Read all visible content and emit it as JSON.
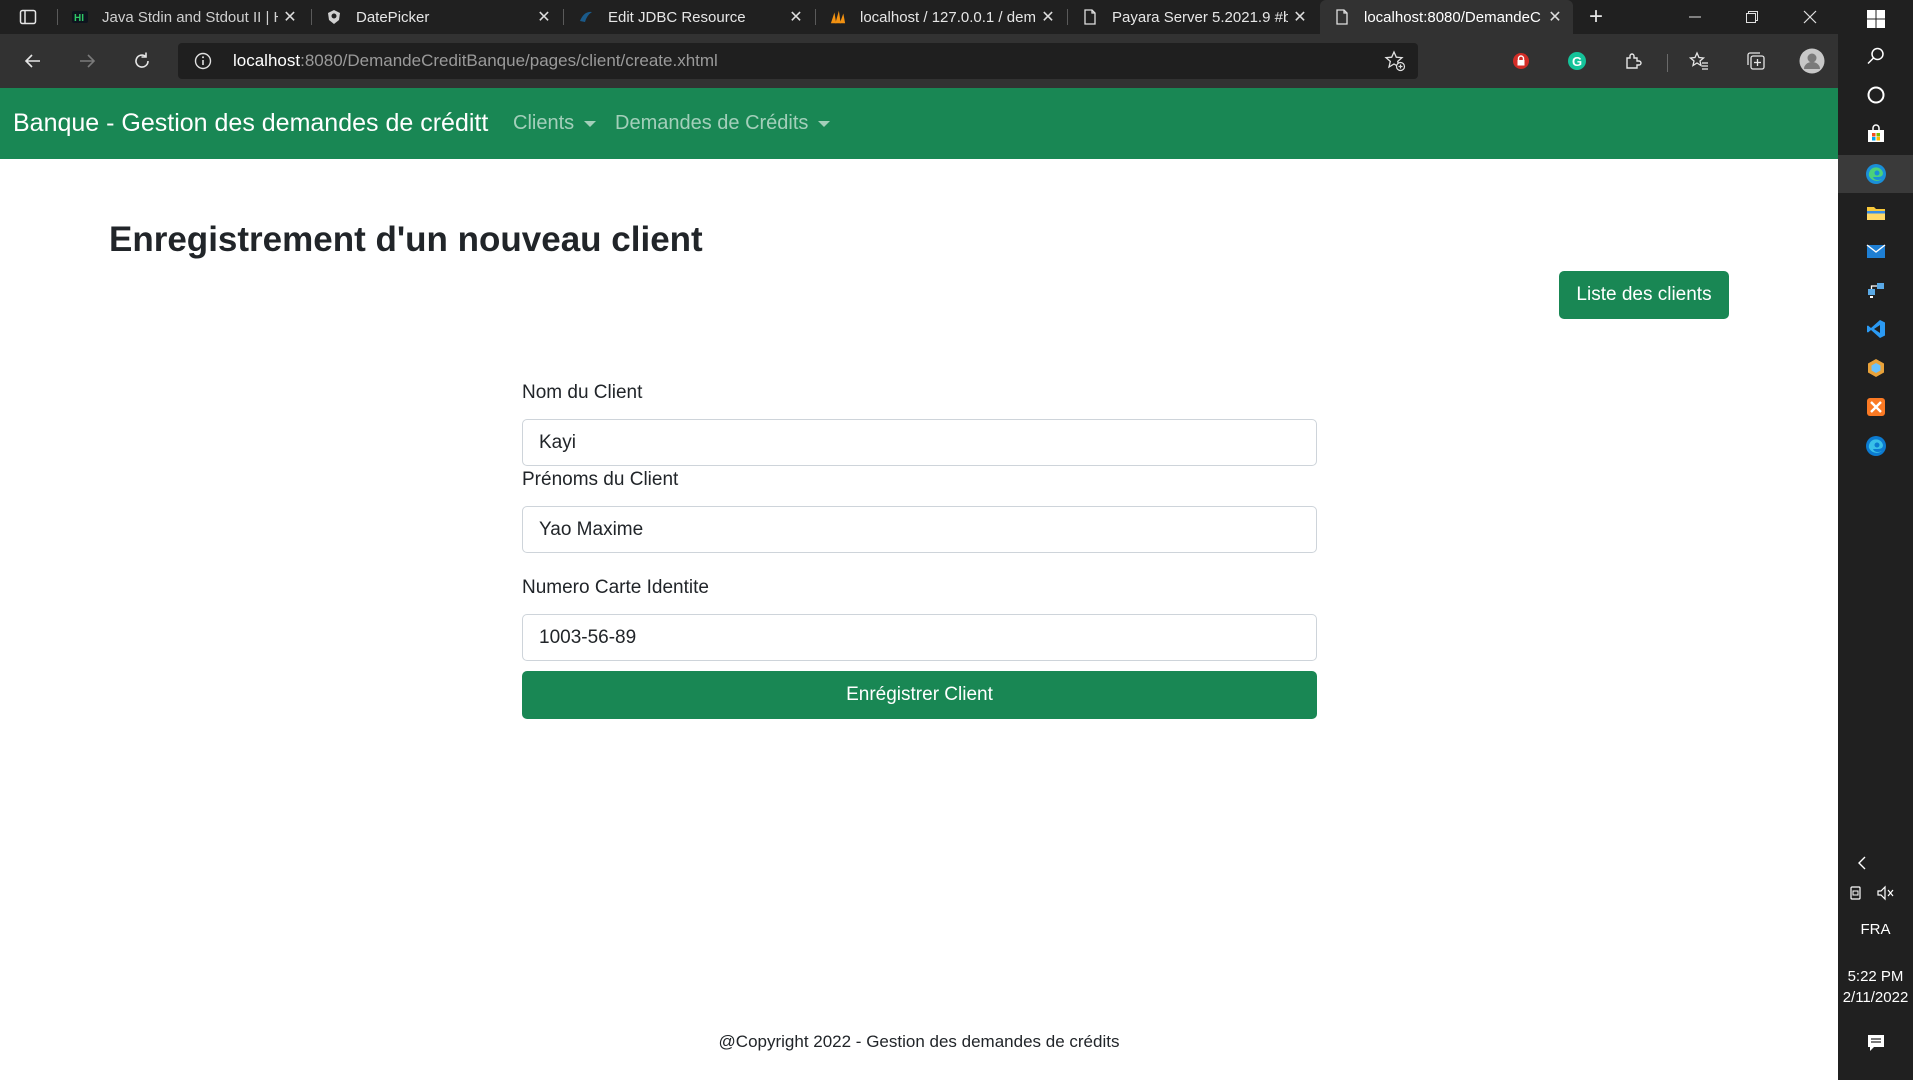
{
  "browser": {
    "tabs": [
      {
        "title": "Java Stdin and Stdout II | H",
        "icon": "hackerrank-icon"
      },
      {
        "title": "DatePicker",
        "icon": "primefaces-icon"
      },
      {
        "title": "Edit JDBC Resource",
        "icon": "glassfish-icon"
      },
      {
        "title": "localhost / 127.0.0.1 / dem",
        "icon": "phpmyadmin-icon"
      },
      {
        "title": "Payara Server 5.2021.9 #b",
        "icon": "page-icon"
      },
      {
        "title": "localhost:8080/DemandeC",
        "icon": "page-icon",
        "active": true
      }
    ],
    "address": {
      "host": "localhost",
      "path": ":8080/DemandeCreditBanque/pages/client/create.xhtml"
    }
  },
  "navbar": {
    "brand": "Banque - Gestion des demandes de créditt",
    "menu": [
      {
        "label": "Clients"
      },
      {
        "label": "Demandes de Crédits"
      }
    ]
  },
  "main": {
    "title": "Enregistrement d'un nouveau client",
    "list_button": "Liste des clients",
    "form": {
      "nom_label": "Nom du Client",
      "nom_value": "Kayi",
      "prenoms_label": "Prénoms du Client",
      "prenoms_value": "Yao Maxime",
      "carte_label": "Numero Carte Identite",
      "carte_value": "1003-56-89",
      "submit": "Enrégistrer Client"
    }
  },
  "footer": {
    "text": "@Copyright 2022 - Gestion des demandes de crédits"
  },
  "taskbar": {
    "language": "FRA",
    "time": "5:22 PM",
    "date": "2/11/2022"
  },
  "colors": {
    "brand_green": "#198754",
    "chrome_dark": "#202020",
    "toolbar": "#323232"
  }
}
